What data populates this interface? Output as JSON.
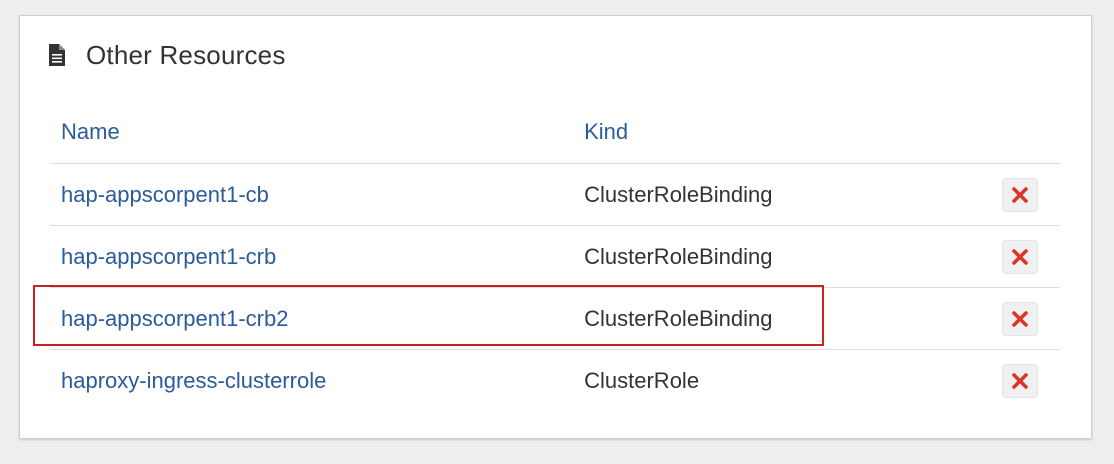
{
  "panel": {
    "title": "Other Resources",
    "icon": "document-icon"
  },
  "table": {
    "headers": {
      "name": "Name",
      "kind": "Kind"
    },
    "rows": [
      {
        "name": "hap-appscorpent1-cb",
        "kind": "ClusterRoleBinding"
      },
      {
        "name": "hap-appscorpent1-crb",
        "kind": "ClusterRoleBinding"
      },
      {
        "name": "hap-appscorpent1-crb2",
        "kind": "ClusterRoleBinding",
        "highlighted": true
      },
      {
        "name": "haproxy-ingress-clusterrole",
        "kind": "ClusterRole"
      }
    ]
  },
  "colors": {
    "link": "#2a5b9a",
    "delete_icon": "#d9362b",
    "highlight": "#cc1f1f"
  }
}
